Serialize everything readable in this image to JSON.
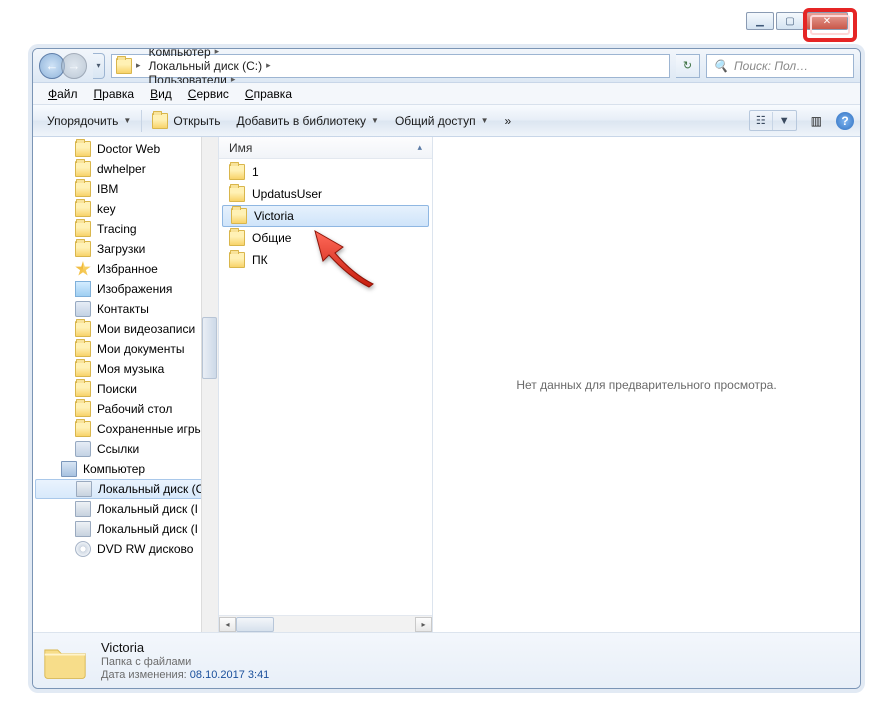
{
  "window_controls": {
    "min": "▁",
    "max": "▢",
    "close": "✕"
  },
  "nav": {
    "back": "←",
    "forward": "→",
    "drop": "▾",
    "refresh": "↻"
  },
  "breadcrumb": [
    {
      "label": "Компьютер"
    },
    {
      "label": "Локальный диск (C:)"
    },
    {
      "label": "Пользователи"
    }
  ],
  "search": {
    "placeholder": "Поиск: Пол…",
    "icon": "🔍"
  },
  "menu": [
    {
      "label": "Файл",
      "u": "Ф"
    },
    {
      "label": "Правка",
      "u": "П"
    },
    {
      "label": "Вид",
      "u": "В"
    },
    {
      "label": "Сервис",
      "u": "С"
    },
    {
      "label": "Справка",
      "u": "С"
    }
  ],
  "toolbar": {
    "organize": "Упорядочить",
    "open": "Открыть",
    "library": "Добавить в библиотеку",
    "share": "Общий доступ",
    "more": "»",
    "help": "?"
  },
  "sidebar": [
    {
      "icon": "folder",
      "label": "Doctor Web"
    },
    {
      "icon": "folder",
      "label": "dwhelper"
    },
    {
      "icon": "folder",
      "label": "IBM"
    },
    {
      "icon": "folder",
      "label": "key"
    },
    {
      "icon": "folder",
      "label": "Tracing"
    },
    {
      "icon": "folder",
      "label": "Загрузки"
    },
    {
      "icon": "star",
      "label": "Избранное"
    },
    {
      "icon": "pic",
      "label": "Изображения"
    },
    {
      "icon": "link",
      "label": "Контакты"
    },
    {
      "icon": "folder",
      "label": "Мои видеозаписи"
    },
    {
      "icon": "folder",
      "label": "Мои документы"
    },
    {
      "icon": "folder",
      "label": "Моя музыка"
    },
    {
      "icon": "folder",
      "label": "Поиски"
    },
    {
      "icon": "folder",
      "label": "Рабочий стол"
    },
    {
      "icon": "folder",
      "label": "Сохраненные игры"
    },
    {
      "icon": "link",
      "label": "Ссылки"
    },
    {
      "icon": "computer",
      "label": "Компьютер",
      "level": 1
    },
    {
      "icon": "drive",
      "label": "Локальный диск (C",
      "selected": true
    },
    {
      "icon": "drive",
      "label": "Локальный диск (I"
    },
    {
      "icon": "drive",
      "label": "Локальный диск (I"
    },
    {
      "icon": "dvd",
      "label": "DVD RW дисково"
    }
  ],
  "column_header": "Имя",
  "files": [
    {
      "name": "1"
    },
    {
      "name": "UpdatusUser"
    },
    {
      "name": "Victoria",
      "selected": true
    },
    {
      "name": "Общие"
    },
    {
      "name": "ПК"
    }
  ],
  "preview_empty": "Нет данных для предварительного просмотра.",
  "details": {
    "title": "Victoria",
    "type": "Папка с файлами",
    "mod_label": "Дата изменения:",
    "mod_value": "08.10.2017 3:41"
  }
}
